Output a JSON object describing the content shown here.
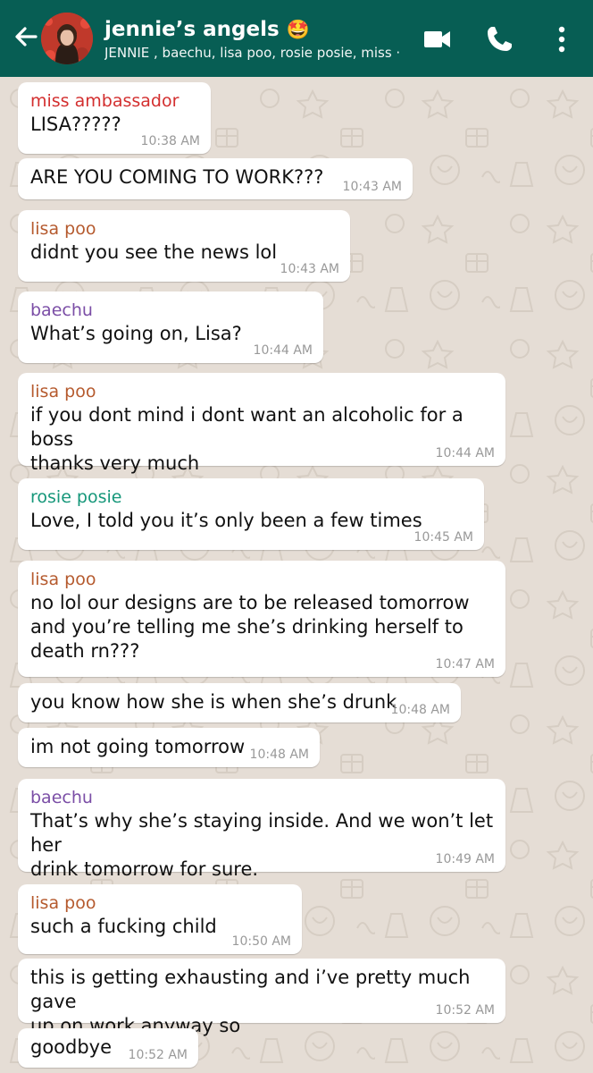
{
  "header": {
    "title": "jennie’s angels",
    "title_emoji": "🤩",
    "subtitle": "JENNIE , baechu, lisa poo, rosie posie, miss ·  ·",
    "background": "#075e54",
    "icons": [
      "back-arrow-icon",
      "avatar",
      "video-call-icon",
      "phone-icon",
      "more-vert-icon"
    ]
  },
  "colors": {
    "miss_ambassador": "#d32f2f",
    "lisa_poo": "#b55a2e",
    "baechu": "#7b4ea6",
    "rosie_posie": "#16977a"
  },
  "messages": [
    {
      "sender": "miss ambassador",
      "text": "LISA?????",
      "time": "10:38 AM"
    },
    {
      "sender": "",
      "text": "ARE YOU COMING TO WORK???",
      "time": "10:43 AM"
    },
    {
      "sender": "lisa poo",
      "text": "didnt you see the news lol",
      "time": "10:43 AM"
    },
    {
      "sender": "baechu",
      "text": "What’s going on, Lisa?",
      "time": "10:44 AM"
    },
    {
      "sender": "lisa poo",
      "text": "if you dont mind i dont want an alcoholic for a boss\nthanks very much",
      "time": "10:44 AM"
    },
    {
      "sender": "rosie posie",
      "text": "Love, I told you it’s only been a few times",
      "time": "10:45 AM"
    },
    {
      "sender": "lisa poo",
      "text": "no lol our designs are to be released tomorrow\nand you’re telling me she’s drinking herself to\ndeath rn???",
      "time": "10:47 AM"
    },
    {
      "sender": "",
      "text": "you know how she is when she’s drunk",
      "time": "10:48 AM"
    },
    {
      "sender": "",
      "text": "im not going tomorrow",
      "time": "10:48 AM"
    },
    {
      "sender": "baechu",
      "text": "That’s why she’s staying inside. And we won’t let her\ndrink tomorrow for sure.",
      "time": "10:49 AM"
    },
    {
      "sender": "lisa poo",
      "text": "such a fucking child",
      "time": "10:50 AM"
    },
    {
      "sender": "",
      "text": "this is getting exhausting and i’ve pretty much gave\nup on work anyway so",
      "time": "10:52 AM"
    },
    {
      "sender": "",
      "text": "goodbye",
      "time": "10:52 AM"
    }
  ]
}
